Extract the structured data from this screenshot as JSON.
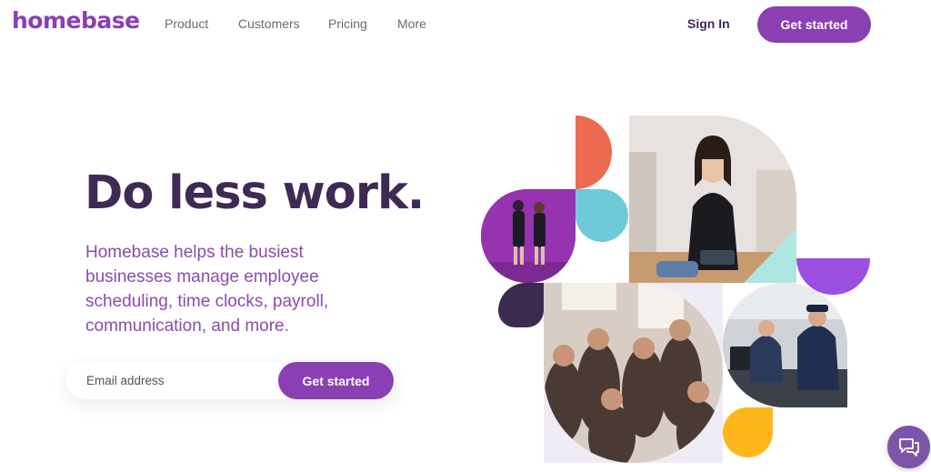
{
  "brand": {
    "logo": "homebase",
    "accent": "#8a3fb3",
    "dark": "#3f2a56"
  },
  "nav": {
    "items": [
      "Product",
      "Customers",
      "Pricing",
      "More"
    ],
    "sign_in": "Sign In",
    "cta": "Get started"
  },
  "hero": {
    "headline": "Do less work.",
    "subtext": "Homebase helps the busiest businesses manage employee scheduling, time clocks, payroll, communication, and more.",
    "email_placeholder": "Email address",
    "email_value": "",
    "cta": "Get started"
  },
  "collage": {
    "shape_colors": {
      "coral": "#ec6a4f",
      "teal": "#6ecad9",
      "lavender": "#f0ecf6",
      "mint": "#aee6e3",
      "violet": "#9b4fe0",
      "plum": "#3d2b4f",
      "yellow": "#fdb71c"
    },
    "photos": [
      "two-employees-purple-wall",
      "shop-owner-folding-clothes",
      "team-group-photo",
      "technicians-at-laptop"
    ]
  },
  "chat": {
    "icon": "chat-bubbles-icon"
  }
}
